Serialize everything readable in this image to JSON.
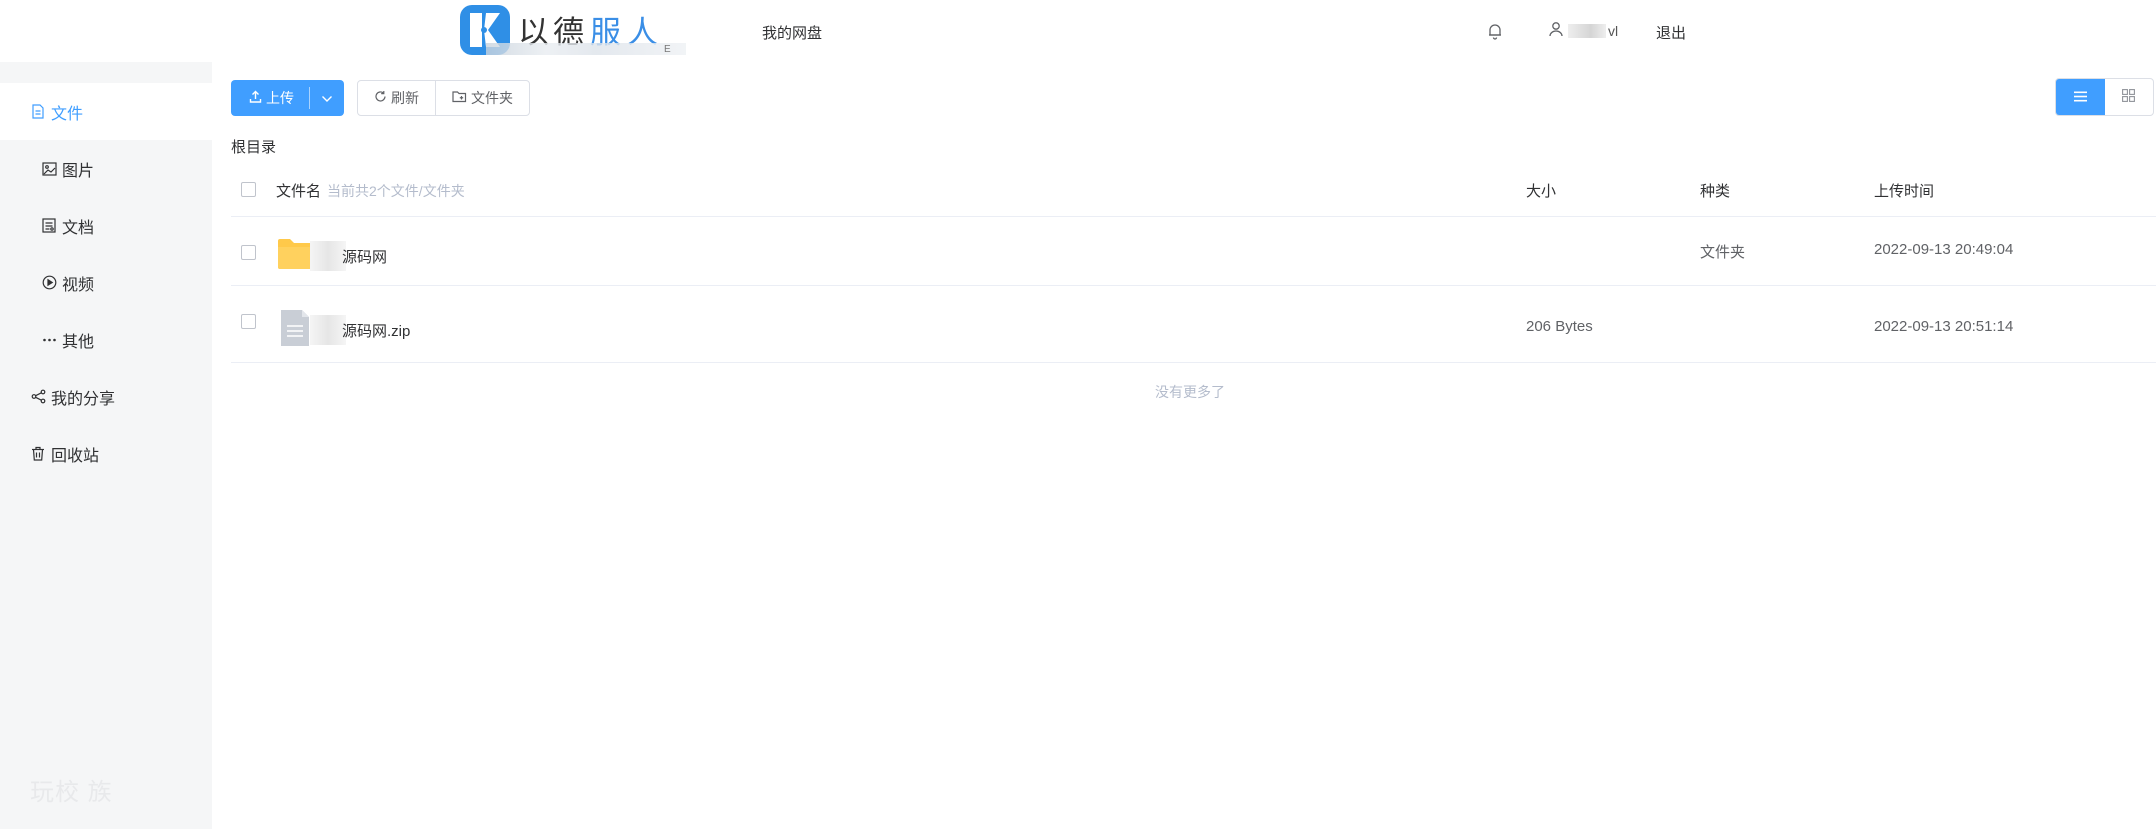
{
  "header": {
    "logo_text_dark": "以德",
    "logo_text_blue": "服人",
    "logo_sub_tail": "E",
    "nav_link": "我的网盘",
    "user_tail": "vl",
    "logout": "退出"
  },
  "sidebar": {
    "items": [
      {
        "label": "文件",
        "icon": "file-icon",
        "active": true
      },
      {
        "label": "图片",
        "icon": "image-icon",
        "active": false
      },
      {
        "label": "文档",
        "icon": "document-icon",
        "active": false
      },
      {
        "label": "视频",
        "icon": "video-icon",
        "active": false
      },
      {
        "label": "其他",
        "icon": "more-icon",
        "active": false
      },
      {
        "label": "我的分享",
        "icon": "share-icon",
        "active": false
      },
      {
        "label": "回收站",
        "icon": "trash-icon",
        "active": false
      }
    ],
    "watermark": "玩校  族"
  },
  "toolbar": {
    "upload_label": "上传",
    "refresh_label": "刷新",
    "new_folder_label": "文件夹"
  },
  "breadcrumb": "根目录",
  "table": {
    "columns": {
      "name": "文件名",
      "name_hint": "当前共2个文件/文件夹",
      "size": "大小",
      "type": "种类",
      "upload_time": "上传时间"
    },
    "rows": [
      {
        "name": "源码网",
        "icon": "folder-icon",
        "size": "",
        "type": "文件夹",
        "upload_time": "2022-09-13 20:49:04"
      },
      {
        "name": "源码网.zip",
        "icon": "file-zip-icon",
        "size": "206 Bytes",
        "type": "",
        "upload_time": "2022-09-13 20:51:14"
      }
    ],
    "footer": "没有更多了"
  },
  "colors": {
    "primary": "#409eff",
    "folder": "#ffc94a",
    "sidebar_bg": "#f5f6f7",
    "hint": "#b4bccc"
  }
}
